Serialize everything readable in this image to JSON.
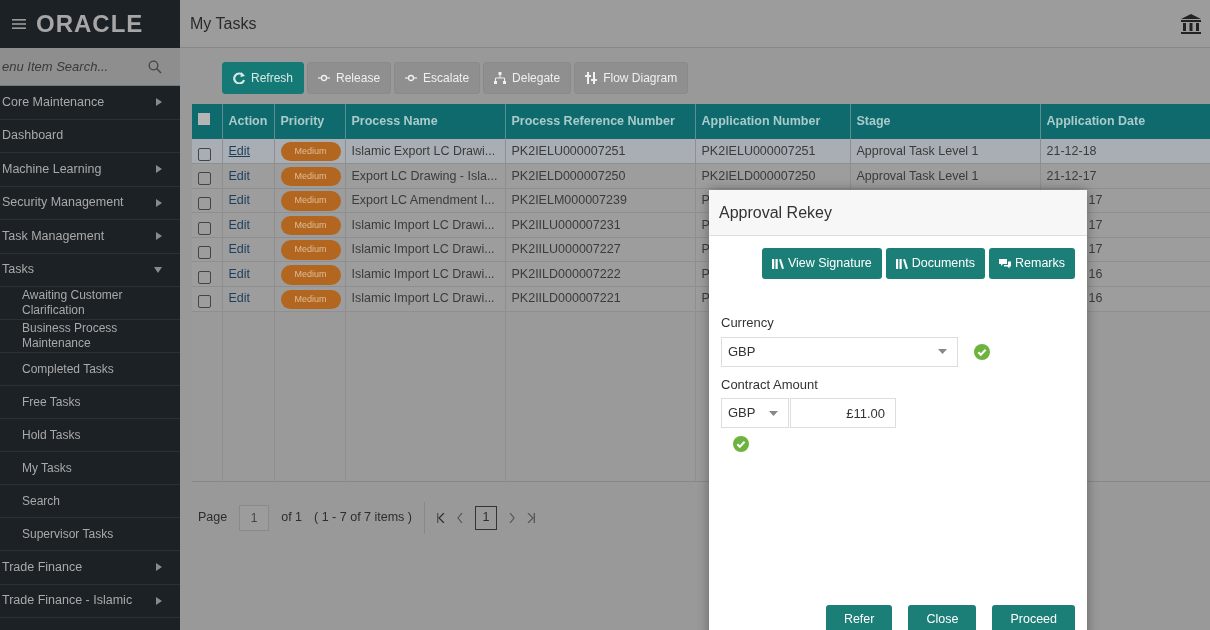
{
  "sidebar": {
    "logo": "ORACLE",
    "search": {
      "placeholder": "enu Item Search..."
    },
    "items": [
      {
        "label": "Core Maintenance",
        "kind": "parent",
        "expanded": false
      },
      {
        "label": "Dashboard",
        "kind": "leaf"
      },
      {
        "label": "Machine Learning",
        "kind": "parent",
        "expanded": false
      },
      {
        "label": "Security Management",
        "kind": "parent",
        "expanded": false
      },
      {
        "label": "Task Management",
        "kind": "parent",
        "expanded": false
      },
      {
        "label": "Tasks",
        "kind": "parent",
        "expanded": true,
        "children": [
          {
            "label": "Awaiting Customer Clarification"
          },
          {
            "label": "Business Process Maintenance"
          },
          {
            "label": "Completed Tasks"
          },
          {
            "label": "Free Tasks"
          },
          {
            "label": "Hold Tasks"
          },
          {
            "label": "My Tasks"
          },
          {
            "label": "Search"
          },
          {
            "label": "Supervisor Tasks"
          }
        ]
      },
      {
        "label": "Trade Finance",
        "kind": "parent",
        "expanded": false
      },
      {
        "label": "Trade Finance - Islamic",
        "kind": "parent",
        "expanded": false
      }
    ]
  },
  "header": {
    "title": "My Tasks"
  },
  "toolbar": [
    {
      "label": "Refresh",
      "disabled": false
    },
    {
      "label": "Release",
      "disabled": true
    },
    {
      "label": "Escalate",
      "disabled": true
    },
    {
      "label": "Delegate",
      "disabled": true
    },
    {
      "label": "Flow Diagram",
      "disabled": true
    }
  ],
  "table": {
    "select_all": {
      "checked": false
    },
    "columns": [
      "Action",
      "Priority",
      "Process Name",
      "Process Reference Number",
      "Application Number",
      "Stage",
      "Application Date"
    ],
    "rows": [
      {
        "selected": true,
        "checked": false,
        "covered": false,
        "action": "Edit",
        "priority": "Medium",
        "process_name": "Islamic Export LC Drawi...",
        "process_reference_number": "PK2IELU000007251",
        "application_number": "PK2IELU000007251",
        "stage": "Approval Task Level 1",
        "application_date": "21-12-18"
      },
      {
        "selected": false,
        "checked": false,
        "covered": false,
        "action": "Edit",
        "priority": "Medium",
        "process_name": "Export LC Drawing - Isla...",
        "process_reference_number": "PK2IELD000007250",
        "application_number": "PK2IELD000007250",
        "stage": "Approval Task Level 1",
        "application_date": "21-12-17"
      },
      {
        "selected": false,
        "checked": false,
        "covered": true,
        "action": "Edit",
        "priority": "Medium",
        "process_name": "Export LC Amendment I...",
        "process_reference_number": "PK2IELM000007239",
        "application_number": "P",
        "application_date": "17"
      },
      {
        "selected": false,
        "checked": false,
        "covered": true,
        "action": "Edit",
        "priority": "Medium",
        "process_name": "Islamic Import LC Drawi...",
        "process_reference_number": "PK2IILU000007231",
        "application_number": "P",
        "application_date": "17"
      },
      {
        "selected": false,
        "checked": false,
        "covered": true,
        "action": "Edit",
        "priority": "Medium",
        "process_name": "Islamic Import LC Drawi...",
        "process_reference_number": "PK2IILU000007227",
        "application_number": "P",
        "application_date": "17"
      },
      {
        "selected": false,
        "checked": false,
        "covered": true,
        "action": "Edit",
        "priority": "Medium",
        "process_name": "Islamic Import LC Drawi...",
        "process_reference_number": "PK2IILD000007222",
        "application_number": "P",
        "application_date": "16"
      },
      {
        "selected": false,
        "checked": false,
        "covered": true,
        "action": "Edit",
        "priority": "Medium",
        "process_name": "Islamic Import LC Drawi...",
        "process_reference_number": "PK2IILD000007221",
        "application_number": "P",
        "application_date": "16"
      }
    ]
  },
  "pagination": {
    "label": "Page",
    "page": "1",
    "of": "of 1",
    "summary": "( 1 - 7 of 7 items )",
    "current": "1"
  },
  "dialog": {
    "title": "Approval Rekey",
    "buttons": [
      {
        "label": "View Signature"
      },
      {
        "label": "Documents"
      },
      {
        "label": "Remarks"
      }
    ],
    "currency": {
      "label": "Currency",
      "value": "GBP",
      "valid": true
    },
    "contract_amount": {
      "label": "Contract Amount",
      "currency": "GBP",
      "amount": "£11.00",
      "valid": true
    },
    "footer": [
      "Refer",
      "Close",
      "Proceed"
    ]
  }
}
